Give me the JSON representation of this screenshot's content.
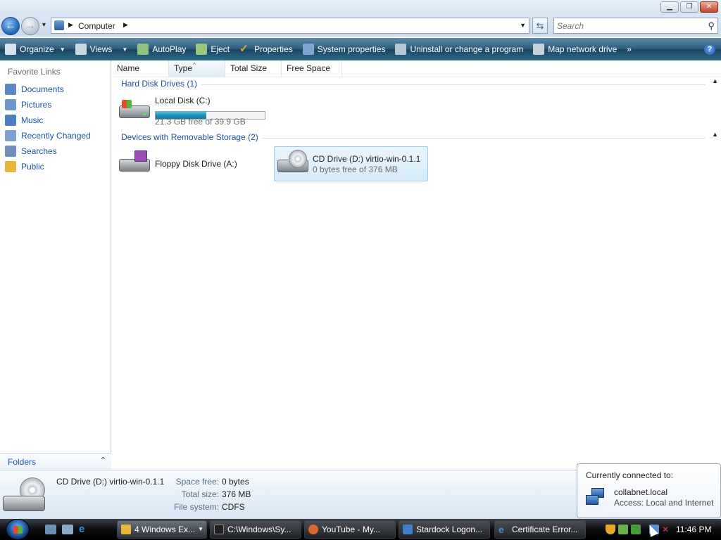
{
  "address": {
    "crumb": "Computer"
  },
  "search": {
    "placeholder": "Search"
  },
  "toolbar": {
    "items": [
      {
        "label": "Organize",
        "icon": "organize-icon",
        "has_dropdown": true
      },
      {
        "label": "Views",
        "icon": "views-icon",
        "has_dropdown": true
      },
      {
        "label": "AutoPlay",
        "icon": "autoplay-icon"
      },
      {
        "label": "Eject",
        "icon": "eject-icon"
      },
      {
        "label": "Properties",
        "icon": "properties-checkmark-icon"
      },
      {
        "label": "System properties",
        "icon": "system-properties-icon"
      },
      {
        "label": "Uninstall or change a program",
        "icon": "uninstall-icon"
      },
      {
        "label": "Map network drive",
        "icon": "network-drive-icon"
      }
    ],
    "overflow": "»"
  },
  "sidebar": {
    "title": "Favorite Links",
    "items": [
      {
        "label": "Documents",
        "color": "#5b87c7"
      },
      {
        "label": "Pictures",
        "color": "#6f96c9"
      },
      {
        "label": "Music",
        "color": "#4d7fc4"
      },
      {
        "label": "Recently Changed",
        "color": "#7ea0cf"
      },
      {
        "label": "Searches",
        "color": "#6f8fbf"
      },
      {
        "label": "Public",
        "color": "#e8b73a"
      }
    ],
    "folders_label": "Folders"
  },
  "columns": [
    "Name",
    "Type",
    "Total Size",
    "Free Space"
  ],
  "groups": {
    "hard": "Hard Disk Drives (1)",
    "removable": "Devices with Removable Storage (2)"
  },
  "drives": {
    "local": {
      "name": "Local Disk (C:)",
      "free": "21.3 GB free of 39.9 GB",
      "used_fraction": 0.466
    },
    "floppy": {
      "name": "Floppy Disk Drive (A:)"
    },
    "cd": {
      "name": "CD Drive (D:) virtio-win-0.1.1",
      "free": "0 bytes free of 376 MB"
    }
  },
  "details": {
    "name": "CD Drive (D:) virtio-win-0.1.1",
    "space_free_label": "Space free:",
    "space_free": "0 bytes",
    "total_size_label": "Total size:",
    "total_size": "376 MB",
    "file_system_label": "File system:",
    "file_system": "CDFS"
  },
  "balloon": {
    "title": "Currently connected to:",
    "network": "collabnet.local",
    "access": "Access:  Local and Internet"
  },
  "taskbar": {
    "buttons": [
      {
        "label": "4 Windows Ex...",
        "color": "#e8b73a"
      },
      {
        "label": "C:\\Windows\\Sy...",
        "color": "#222222"
      },
      {
        "label": "YouTube - My...",
        "color": "#d9682e"
      },
      {
        "label": "Stardock Logon...",
        "color": "#3f7fc8"
      },
      {
        "label": "Certificate Error...",
        "color": "#3c7fd3"
      }
    ],
    "clock": "11:46 PM"
  }
}
